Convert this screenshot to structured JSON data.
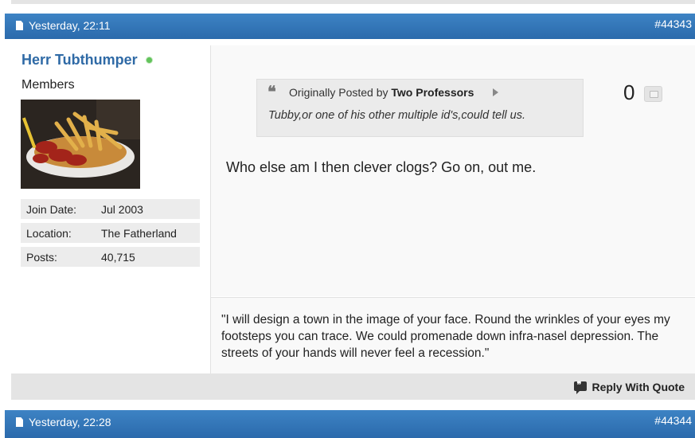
{
  "post1": {
    "date": "Yesterday, 22:11",
    "number": "#44343"
  },
  "user": {
    "name": "Herr Tubthumper",
    "title": "Members",
    "avatar_icon": "currywurst-fries-photo",
    "stats": [
      {
        "label": "Join Date:",
        "value": "Jul 2003"
      },
      {
        "label": "Location:",
        "value": "The Fatherland"
      },
      {
        "label": "Posts:",
        "value": "40,715"
      }
    ]
  },
  "quote": {
    "prefix": "Originally Posted by",
    "author": "Two Professors",
    "text": "Tubby,or one of his other multiple id's,could tell us."
  },
  "vote": {
    "count": "0"
  },
  "message": "Who else am I then clever clogs? Go on, out me.",
  "signature": "\"I will design a town in the image of your face. Round the wrinkles of your eyes my footsteps you can trace. We could promenade down infra-nasel depression. The streets of your hands will never feel a recession.\"",
  "footer": {
    "reply_label": "Reply With Quote"
  },
  "post2": {
    "date": "Yesterday, 22:28",
    "number": "#44344"
  },
  "colors": {
    "header_blue": "#2f72b5",
    "username_blue": "#2f6aa6",
    "online_green": "#62c35b"
  }
}
